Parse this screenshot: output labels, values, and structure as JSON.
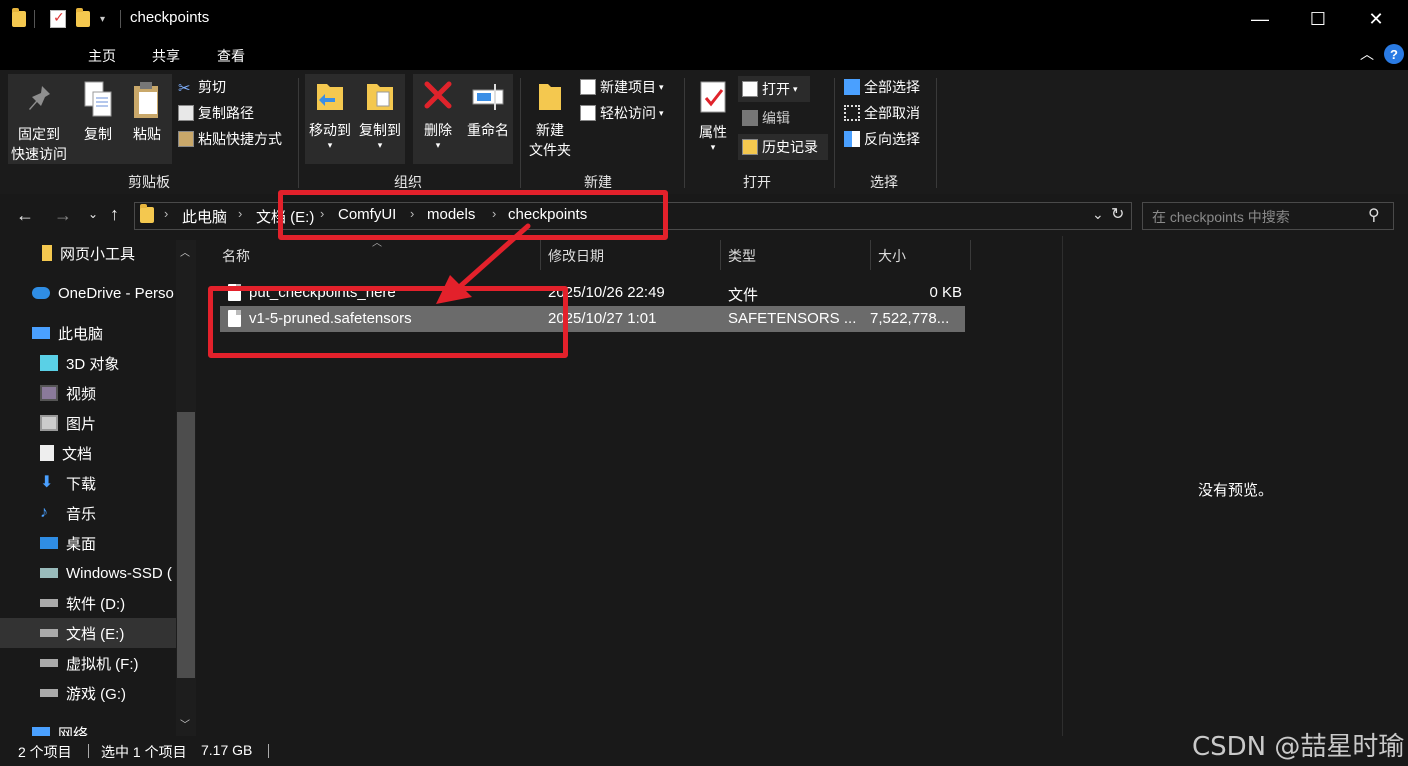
{
  "window": {
    "title": "checkpoints",
    "controls": {
      "minimize": "—",
      "maximize": "☐",
      "close": "✕"
    },
    "help": "?"
  },
  "ribbon_tabs": [
    "主页",
    "共享",
    "查看"
  ],
  "ribbon": {
    "clipboard": {
      "label": "剪贴板",
      "pin_line1": "固定到",
      "pin_line2": "快速访问",
      "copy": "复制",
      "paste": "粘贴",
      "cut": "剪切",
      "copy_path": "复制路径",
      "paste_shortcut": "粘贴快捷方式"
    },
    "organize": {
      "label": "组织",
      "move_to": "移动到",
      "copy_to": "复制到",
      "delete": "删除",
      "rename": "重命名"
    },
    "new": {
      "label": "新建",
      "new_folder_line1": "新建",
      "new_folder_line2": "文件夹",
      "new_item": "新建项目",
      "easy_access": "轻松访问"
    },
    "open": {
      "label": "打开",
      "properties": "属性",
      "open": "打开",
      "edit": "编辑",
      "history": "历史记录"
    },
    "select": {
      "label": "选择",
      "select_all": "全部选择",
      "select_none": "全部取消",
      "invert": "反向选择"
    }
  },
  "breadcrumb": [
    "此电脑",
    "文档 (E:)",
    "ComfyUI",
    "models",
    "checkpoints"
  ],
  "search": {
    "placeholder": "在 checkpoints 中搜索"
  },
  "nav_items": [
    {
      "label": "网页小工具",
      "icon": "folder-icon"
    },
    {
      "label": "OneDrive - Perso",
      "icon": "cloud-icon"
    },
    {
      "label": "此电脑",
      "icon": "computer-icon"
    },
    {
      "label": "3D 对象",
      "icon": "cube-icon"
    },
    {
      "label": "视频",
      "icon": "video-icon"
    },
    {
      "label": "图片",
      "icon": "picture-icon"
    },
    {
      "label": "文档",
      "icon": "document-icon"
    },
    {
      "label": "下载",
      "icon": "download-icon"
    },
    {
      "label": "音乐",
      "icon": "music-icon"
    },
    {
      "label": "桌面",
      "icon": "desktop-icon"
    },
    {
      "label": "Windows-SSD (",
      "icon": "drive-icon"
    },
    {
      "label": "软件 (D:)",
      "icon": "drive-icon"
    },
    {
      "label": "文档 (E:)",
      "icon": "drive-icon"
    },
    {
      "label": "虚拟机 (F:)",
      "icon": "drive-icon"
    },
    {
      "label": "游戏 (G:)",
      "icon": "drive-icon"
    },
    {
      "label": "网络",
      "icon": "network-icon"
    }
  ],
  "columns": {
    "name": "名称",
    "date": "修改日期",
    "type": "类型",
    "size": "大小"
  },
  "files": [
    {
      "name": "put_checkpoints_here",
      "date": "2025/10/26 22:49",
      "type": "文件",
      "size": "0 KB",
      "selected": false
    },
    {
      "name": "v1-5-pruned.safetensors",
      "date": "2025/10/27 1:01",
      "type": "SAFETENSORS ...",
      "size": "7,522,778...",
      "selected": true
    }
  ],
  "preview": {
    "text": "没有预览。"
  },
  "status": {
    "count": "2 个项目",
    "selected": "选中 1 个项目",
    "size": "7.17 GB"
  },
  "watermark": "CSDN @喆星时瑜",
  "colors": {
    "accent": "#e3212b",
    "selection": "#6b6b6b",
    "folder": "#f4c84f",
    "background": "#191919"
  }
}
